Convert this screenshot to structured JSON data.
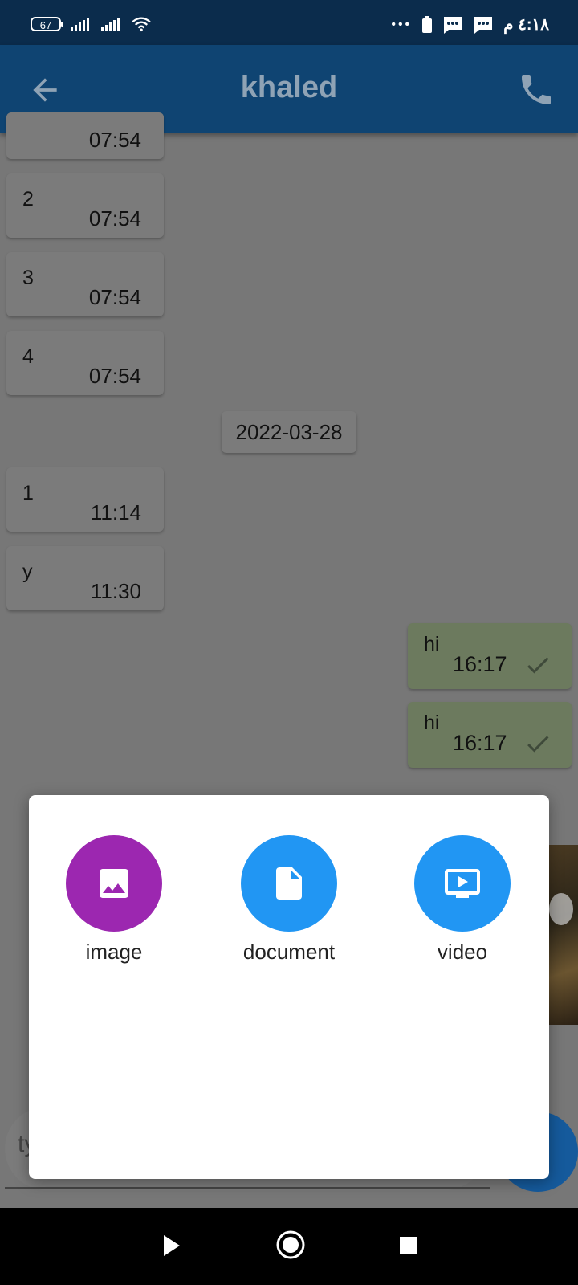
{
  "status_bar": {
    "battery_level": "67",
    "dots": "•••",
    "time": "٤:١٨ م"
  },
  "app_bar": {
    "title": "khaled",
    "back_icon": "arrow-back-icon",
    "call_icon": "phone-icon"
  },
  "messages": [
    {
      "text": "",
      "time": "07:54"
    },
    {
      "text": "2",
      "time": "07:54"
    },
    {
      "text": "3",
      "time": "07:54"
    },
    {
      "text": "4",
      "time": "07:54"
    },
    {
      "text": "1",
      "time": "11:14"
    },
    {
      "text": "y",
      "time": "11:30"
    }
  ],
  "date_separator": "2022-03-28",
  "outgoing": [
    {
      "text": "hi",
      "time": "16:17",
      "status_icon": "check-icon"
    },
    {
      "text": "hi",
      "time": "16:17",
      "status_icon": "check-icon"
    }
  ],
  "input": {
    "placeholder_visible": "ty"
  },
  "attachment_dialog": {
    "options": [
      {
        "label": "image",
        "icon": "image-icon",
        "color": "#9c27b0"
      },
      {
        "label": "document",
        "icon": "document-icon",
        "color": "#2196f3"
      },
      {
        "label": "video",
        "icon": "video-icon",
        "color": "#2196f3"
      }
    ]
  },
  "nav_bar": {
    "back_icon": "play-back-icon",
    "home_icon": "home-circle-icon",
    "recents_icon": "recents-square-icon"
  }
}
